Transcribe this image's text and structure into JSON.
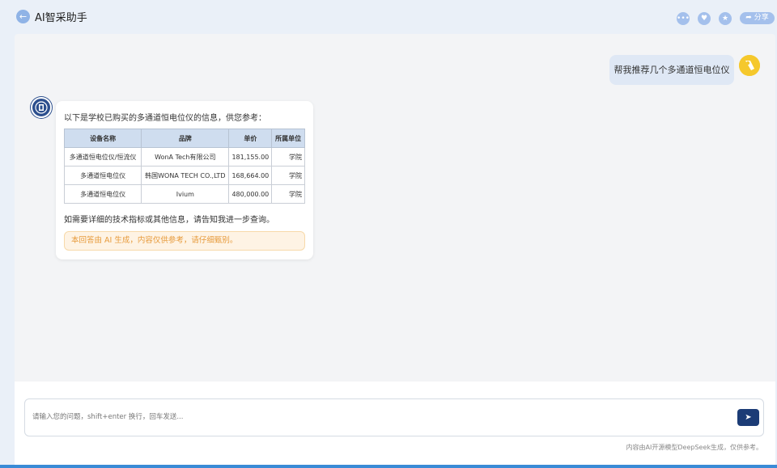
{
  "app": {
    "title": "AI智采助手"
  },
  "header": {
    "share_label": "分享",
    "icons": [
      "more-icon",
      "heart-icon",
      "star-icon",
      "share-icon"
    ]
  },
  "conversation": {
    "user_message": "帮我推荐几个多通道恒电位仪",
    "bot": {
      "intro": "以下是学校已购买的多通道恒电位仪的信息，供您参考：",
      "table": {
        "headers": [
          "设备名称",
          "品牌",
          "单价",
          "所属单位"
        ],
        "rows": [
          [
            "多通道恒电位仪/恒流仪",
            "WonA Tech有限公司",
            "181,155.00",
            "学院"
          ],
          [
            "多通道恒电位仪",
            "韩国WONA TECH CO.,LTD",
            "168,664.00",
            "学院"
          ],
          [
            "多通道恒电位仪",
            "Ivium",
            "480,000.00",
            "学院"
          ]
        ]
      },
      "followup": "如需要详细的技术指标或其他信息，请告知我进一步查询。",
      "disclaimer": "本回答由 AI 生成，内容仅供参考，请仔细甄别。"
    }
  },
  "input": {
    "placeholder": "请输入您的问题，shift+enter 换行，回车发送...",
    "value": ""
  },
  "footer": {
    "note": "内容由AI开源模型DeepSeek生成，仅供参考。"
  },
  "colors": {
    "accent": "#1c3c76",
    "disclaimer_text": "#e79b3c",
    "table_header_bg": "#cfddef"
  }
}
